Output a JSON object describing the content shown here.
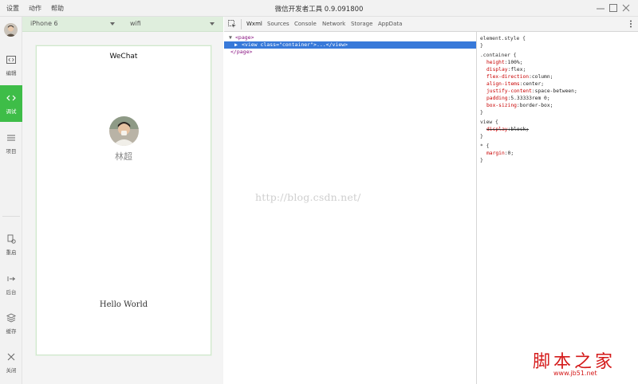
{
  "menu": [
    "设置",
    "动作",
    "帮助"
  ],
  "window_title": "微信开发者工具 0.9.091800",
  "sidebar": {
    "items": [
      {
        "label": "编辑",
        "icon": "code-editor-icon"
      },
      {
        "label": "调试",
        "icon": "debug-icon"
      },
      {
        "label": "项目",
        "icon": "list-icon"
      },
      {
        "label": "重启",
        "icon": "restart-icon"
      },
      {
        "label": "后台",
        "icon": "background-icon"
      },
      {
        "label": "缓存",
        "icon": "cache-icon"
      },
      {
        "label": "关闭",
        "icon": "close-icon"
      }
    ]
  },
  "simulator": {
    "device": "iPhone 6",
    "network": "wifi",
    "nav_title": "WeChat",
    "user_name": "林超",
    "hello_text": "Hello World"
  },
  "devtools": {
    "tabs": [
      "Wxml",
      "Sources",
      "Console",
      "Network",
      "Storage",
      "AppData"
    ],
    "active_tab": "Wxml",
    "dom": {
      "line1_tag": "<page>",
      "line2_open": "<view",
      "line2_attr": "class=",
      "line2_val": "\"container\"",
      "line2_rest": ">...</view>",
      "line3_tag": "</page>"
    },
    "watermark": "http://blog.csdn.net/"
  },
  "styles": {
    "element_style_open": "element.style {",
    "close": "}",
    "container_selector": ".container {",
    "container_rules": [
      {
        "prop": "height",
        "value": "100%;"
      },
      {
        "prop": "display",
        "value": "flex;"
      },
      {
        "prop": "flex-direction",
        "value": "column;"
      },
      {
        "prop": "align-items",
        "value": "center;"
      },
      {
        "prop": "justify-content",
        "value": "space-between;"
      },
      {
        "prop": "padding",
        "value": "5.33333rem 0;"
      },
      {
        "prop": "box-sizing",
        "value": "border-box;"
      }
    ],
    "view_selector": "view {",
    "view_rule": {
      "prop": "display",
      "value": "block;"
    },
    "star_selector": "* {",
    "star_rule": {
      "prop": "margin",
      "value": "0;"
    }
  },
  "site_mark": {
    "big": "脚本之家",
    "small": "www.jb51.net"
  },
  "colors": {
    "accent_green": "#3ebd48",
    "selection_blue": "#3879d9"
  }
}
